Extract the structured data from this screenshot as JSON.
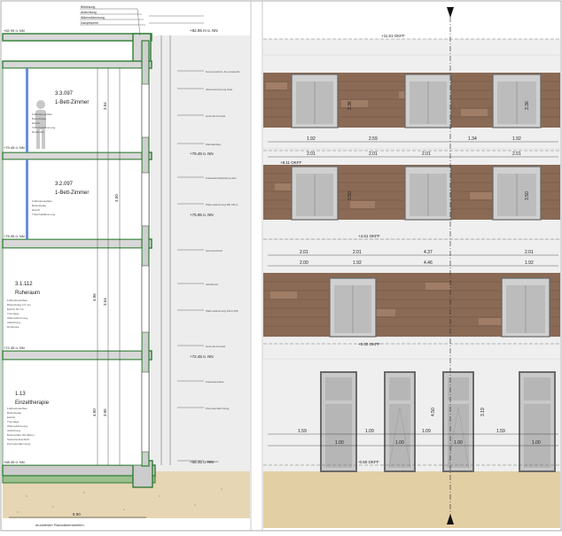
{
  "section": {
    "top_notes": [
      "Bekiesung",
      "Abdichtung",
      "Wärmedämmung",
      "Dampfsperre"
    ],
    "level_labels_left": [
      "+82.95 ü. NN",
      "+79.45 ü. NN",
      "+75.95 ü. NN",
      "+72.45 ü. NN",
      "+68.45 ü. NN"
    ],
    "level_labels_right": [
      "+82.95 m ü. NN",
      "+79.45 ü. NN",
      "+75.95 ü. NN",
      "+72.45 ü. NN",
      "+68.45 ü. NN"
    ],
    "rooms": [
      {
        "number": "3.3.097",
        "name": "1-Bett-Zimmer"
      },
      {
        "number": "3.2.097",
        "name": "1-Bett-Zimmer"
      },
      {
        "number": "3.1.112",
        "name": "Ruheraum"
      },
      {
        "number": "1.13",
        "name": "Einzeltherapie"
      }
    ],
    "vertical_dims": [
      "3.04",
      "3.50",
      "3.54",
      "4.96",
      "3.95",
      "4.50"
    ],
    "bottom_dim": "5.00",
    "bottom_note": "druckfester Randdämmstreifen"
  },
  "elevation": {
    "top_level": "+11.61 OKFF",
    "level_labels": [
      "+8.11 OKFF",
      "+4.61 OKFF",
      "+0.00 OKFF",
      "-0.50 OKFF"
    ],
    "dims_row1": [
      "1.92",
      "2.59",
      "1.34",
      "1.92"
    ],
    "dims_row2": [
      "2.01",
      "2.01",
      "2.01",
      "2.01"
    ],
    "dims_row3": [
      "2.00",
      "1.92",
      "4.46",
      "1.92",
      "2.01"
    ],
    "dims_row3_top": [
      "2.01",
      "2.01",
      "4.37",
      "2.01"
    ],
    "dims_doors": [
      "1.59",
      "1.09",
      "1.09",
      "1.59"
    ],
    "dims_doors2": [
      "1.00",
      "1.00",
      "1.00",
      "1.00"
    ],
    "vert_dims": [
      "3.36",
      "3.50",
      "3.36",
      "3.50",
      "4.50",
      "3.19"
    ]
  }
}
